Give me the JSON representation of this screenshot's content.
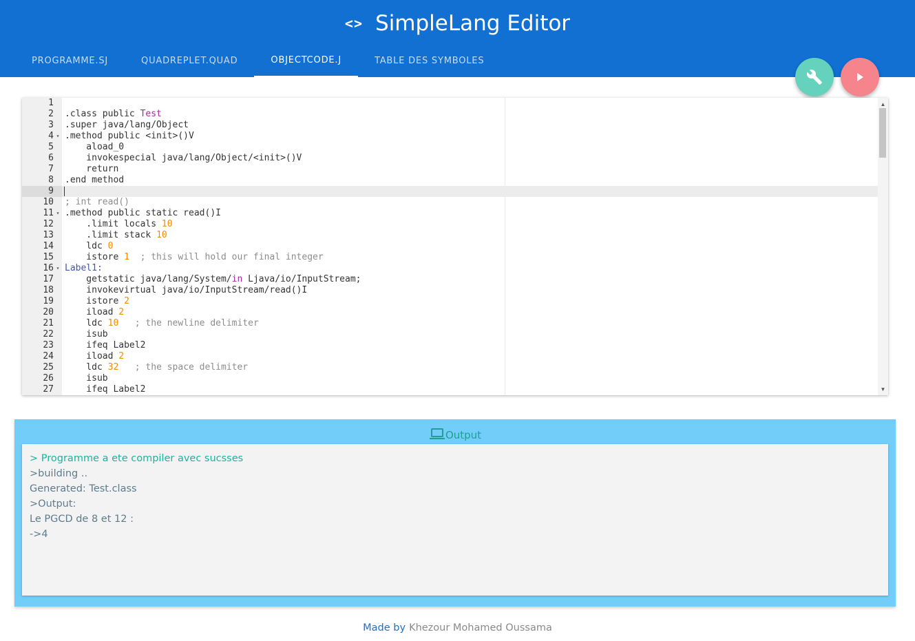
{
  "header": {
    "title": "SimpleLang Editor",
    "icon": "code-icon",
    "background": "#1170d2"
  },
  "tabs": [
    {
      "label": "PROGRAMME.SJ",
      "active": false
    },
    {
      "label": "QUADREPLET.QUAD",
      "active": false
    },
    {
      "label": "OBJECTCODE.J",
      "active": true
    },
    {
      "label": "TABLE DES SYMBOLES",
      "active": false
    }
  ],
  "actions": {
    "build": {
      "icon": "wrench-icon",
      "color": "#64d2bd"
    },
    "run": {
      "icon": "play-icon",
      "color": "#f5848d"
    }
  },
  "editor": {
    "active_line": 9,
    "lines": [
      {
        "n": "1",
        "fold": "",
        "tokens": []
      },
      {
        "n": "2",
        "fold": "",
        "tokens": [
          {
            "t": ".class public "
          },
          {
            "t": "Test",
            "c": "kw"
          }
        ]
      },
      {
        "n": "3",
        "fold": "",
        "tokens": [
          {
            "t": ".super java/lang/Object"
          }
        ]
      },
      {
        "n": "4",
        "fold": "▾",
        "tokens": [
          {
            "t": ".method public <init>()V"
          }
        ]
      },
      {
        "n": "5",
        "fold": "",
        "tokens": [
          {
            "t": "    aload_0"
          }
        ]
      },
      {
        "n": "6",
        "fold": "",
        "tokens": [
          {
            "t": "    invokespecial java/lang/Object/<init>()V"
          }
        ]
      },
      {
        "n": "7",
        "fold": "",
        "tokens": [
          {
            "t": "    return"
          }
        ]
      },
      {
        "n": "8",
        "fold": "",
        "tokens": [
          {
            "t": ".end method"
          }
        ]
      },
      {
        "n": "9",
        "fold": "",
        "tokens": []
      },
      {
        "n": "10",
        "fold": "",
        "tokens": [
          {
            "t": "; int read()",
            "c": "cm"
          }
        ]
      },
      {
        "n": "11",
        "fold": "▾",
        "tokens": [
          {
            "t": ".method public static read()I"
          }
        ]
      },
      {
        "n": "12",
        "fold": "",
        "tokens": [
          {
            "t": "    .limit locals "
          },
          {
            "t": "10",
            "c": "num"
          }
        ]
      },
      {
        "n": "13",
        "fold": "",
        "tokens": [
          {
            "t": "    .limit stack "
          },
          {
            "t": "10",
            "c": "num"
          }
        ]
      },
      {
        "n": "14",
        "fold": "",
        "tokens": [
          {
            "t": "    ldc "
          },
          {
            "t": "0",
            "c": "num"
          }
        ]
      },
      {
        "n": "15",
        "fold": "",
        "tokens": [
          {
            "t": "    istore "
          },
          {
            "t": "1",
            "c": "num"
          },
          {
            "t": "  ; this will hold our final integer",
            "c": "cm"
          }
        ]
      },
      {
        "n": "16",
        "fold": "▾",
        "tokens": [
          {
            "t": "Label1:",
            "c": "lbl"
          }
        ]
      },
      {
        "n": "17",
        "fold": "",
        "tokens": [
          {
            "t": "    getstatic java/lang/System/"
          },
          {
            "t": "in",
            "c": "kw"
          },
          {
            "t": " Ljava/io/InputStream;"
          }
        ]
      },
      {
        "n": "18",
        "fold": "",
        "tokens": [
          {
            "t": "    invokevirtual java/io/InputStream/read()I"
          }
        ]
      },
      {
        "n": "19",
        "fold": "",
        "tokens": [
          {
            "t": "    istore "
          },
          {
            "t": "2",
            "c": "num"
          }
        ]
      },
      {
        "n": "20",
        "fold": "",
        "tokens": [
          {
            "t": "    iload "
          },
          {
            "t": "2",
            "c": "num"
          }
        ]
      },
      {
        "n": "21",
        "fold": "",
        "tokens": [
          {
            "t": "    ldc "
          },
          {
            "t": "10",
            "c": "num"
          },
          {
            "t": "   ; the newline delimiter",
            "c": "cm"
          }
        ]
      },
      {
        "n": "22",
        "fold": "",
        "tokens": [
          {
            "t": "    isub"
          }
        ]
      },
      {
        "n": "23",
        "fold": "",
        "tokens": [
          {
            "t": "    ifeq Label2"
          }
        ]
      },
      {
        "n": "24",
        "fold": "",
        "tokens": [
          {
            "t": "    iload "
          },
          {
            "t": "2",
            "c": "num"
          }
        ]
      },
      {
        "n": "25",
        "fold": "",
        "tokens": [
          {
            "t": "    ldc "
          },
          {
            "t": "32",
            "c": "num"
          },
          {
            "t": "   ; the space delimiter",
            "c": "cm"
          }
        ]
      },
      {
        "n": "26",
        "fold": "",
        "tokens": [
          {
            "t": "    isub"
          }
        ]
      },
      {
        "n": "27",
        "fold": "",
        "tokens": [
          {
            "t": "    ifeq Label2"
          }
        ]
      }
    ]
  },
  "output": {
    "title": "Output",
    "icon": "laptop-icon",
    "lines": [
      {
        "text": "> Programme a ete compiler avec sucsses",
        "type": "success"
      },
      {
        "text": ">building ..",
        "type": "info"
      },
      {
        "text": "Generated: Test.class",
        "type": "info"
      },
      {
        "text": ">Output:",
        "type": "info"
      },
      {
        "text": "Le PGCD de 8 et 12 :",
        "type": "info"
      },
      {
        "text": "->4",
        "type": "info"
      }
    ]
  },
  "footer": {
    "label": "Made by",
    "author": "Khezour Mohamed Oussama"
  }
}
